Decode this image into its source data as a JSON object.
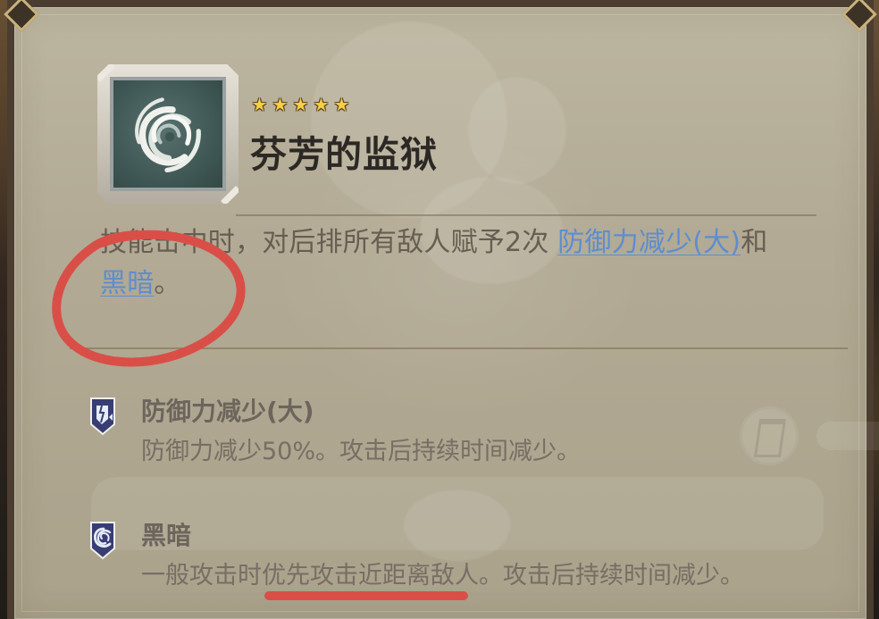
{
  "skill": {
    "name": "芬芳的监狱",
    "rarity": 5,
    "stars": [
      "★",
      "★",
      "★",
      "★",
      "★"
    ],
    "icon": "swirl-skill-icon"
  },
  "description": {
    "prefix": "技能击中时，对后排所有敌人赋予2次 ",
    "effect1": "防御力减少(大)",
    "middle": "和",
    "effect2": "黑暗",
    "suffix": "。"
  },
  "effects": [
    {
      "title": "防御力减少(大)",
      "text": "防御力减少50%。攻击后持续时间减少。",
      "icon": "shield-break-icon"
    },
    {
      "title": "黑暗",
      "text": "一般攻击时优先攻击近距离敌人。攻击后持续时间减少。",
      "icon": "darkness-vortex-icon"
    }
  ],
  "colors": {
    "panel": "#b2aa94",
    "title_text": "#2c2925",
    "body_text": "#675d52",
    "link": "#5d8dd0",
    "annotation": "#d94f48",
    "stars": "#f5cf46"
  }
}
